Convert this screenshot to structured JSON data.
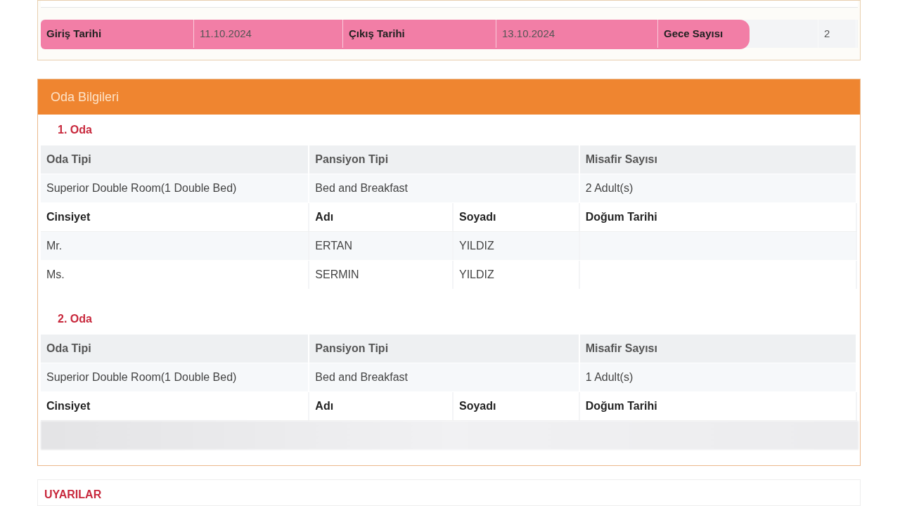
{
  "stay_dates": {
    "highlighted": true,
    "cells": [
      {
        "kind": "label",
        "text": "Giriş Tarihi"
      },
      {
        "kind": "value",
        "text": "11.10.2024"
      },
      {
        "kind": "label",
        "text": "Çıkış Tarihi"
      },
      {
        "kind": "value",
        "text": "13.10.2024"
      },
      {
        "kind": "label",
        "text": "Gece Sayısı"
      },
      {
        "kind": "value",
        "text": "2"
      }
    ]
  },
  "room_info": {
    "title": "Oda Bilgileri",
    "rooms": [
      {
        "title": "1. Oda",
        "room_columns": [
          "Oda Tipi",
          "Pansiyon Tipi",
          "Misafir Sayısı"
        ],
        "room_values": [
          "Superior Double Room(1 Double Bed)",
          "Bed and Breakfast",
          "2 Adult(s)"
        ],
        "guest_columns": [
          "Cinsiyet",
          "Adı",
          "Soyadı",
          "Doğum Tarihi"
        ],
        "guests": [
          {
            "kind": "guest",
            "cells": [
              "Mr.",
              "ERTAN",
              "YILDIZ"
            ]
          },
          {
            "kind": "guest",
            "cells": [
              "Ms.",
              "SERMIN",
              "YILDIZ"
            ]
          }
        ]
      },
      {
        "title": "2. Oda",
        "room_columns": [
          "Oda Tipi",
          "Pansiyon Tipi",
          "Misafir Sayısı"
        ],
        "room_values": [
          "Superior Double Room(1 Double Bed)",
          "Bed and Breakfast",
          "1 Adult(s)"
        ],
        "guest_columns": [
          "Cinsiyet",
          "Adı",
          "Soyadı",
          "Doğum Tarihi"
        ],
        "guests": [
          {
            "kind": "blurred"
          }
        ]
      }
    ]
  },
  "warnings": {
    "title": "UYARILAR"
  }
}
